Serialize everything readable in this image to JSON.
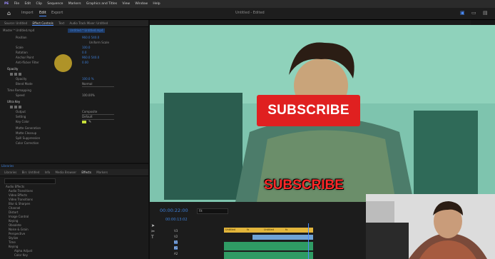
{
  "menu": {
    "app_title": "PE",
    "items": [
      "File",
      "Edit",
      "Clip",
      "Sequence",
      "Markers",
      "Graphics and Titles",
      "View",
      "Window",
      "Help"
    ]
  },
  "workspace": {
    "tabs": [
      "Import",
      "Edit",
      "Export"
    ],
    "active_tab": "Edit",
    "project_title": "Untitled - Edited"
  },
  "effects_panel": {
    "tabs": [
      "Source: Untitled",
      "Effect Controls",
      "Text",
      "Audio Track Mixer: Untitled"
    ],
    "active_tab": "Effect Controls",
    "master_label": "Master * Untitled.mp4",
    "clip_label": "Untitled * Untitled.mp4",
    "rows": [
      {
        "label": "Position",
        "value": "960.0   540.0"
      },
      {
        "label": "Scale",
        "value": "100.0"
      },
      {
        "label": "Scale Width",
        "value": "100.0"
      },
      {
        "label": "Uniform Scale",
        "value": ""
      },
      {
        "label": "Rotation",
        "value": "0.0"
      },
      {
        "label": "Anchor Point",
        "value": "960.0   540.0"
      },
      {
        "label": "Anti-flicker Filter",
        "value": "0.00"
      },
      {
        "label": "Opacity",
        "value": ""
      },
      {
        "label": "Opacity",
        "value": "100.0 %"
      },
      {
        "label": "Blend Mode",
        "value": "Normal"
      },
      {
        "label": "Time Remapping",
        "value": ""
      },
      {
        "label": "Speed",
        "value": "100.00%"
      },
      {
        "label": "Ultra Key",
        "value": ""
      },
      {
        "label": "Output",
        "value": "Composite"
      },
      {
        "label": "Setting",
        "value": "Default"
      },
      {
        "label": "Key Color",
        "value": ""
      },
      {
        "label": "Matte Generation",
        "value": ""
      },
      {
        "label": "Matte Cleanup",
        "value": ""
      },
      {
        "label": "Spill Suppression",
        "value": ""
      },
      {
        "label": "Color Correction",
        "value": ""
      }
    ]
  },
  "browser_panel": {
    "section": "Libraries",
    "tabs": [
      "Libraries",
      "Bin: Untitled",
      "Info",
      "Media Browser",
      "Effects",
      "Markers"
    ],
    "active_tab": "Effects",
    "tree": [
      "Audio Effects",
      "Audio Transitions",
      "Video Effects",
      "Video Transitions",
      "Blur & Sharpen",
      "Channel",
      "Distort",
      "Image Control",
      "Keying",
      "Obsolete",
      "Noise & Grain",
      "Perspective",
      "Stylize",
      "Time",
      "Keying",
      "Alpha Adjust",
      "Color Key",
      "Luma Key",
      "Track Matte Key"
    ]
  },
  "program_monitor": {
    "button_text": "SUBSCRIBE",
    "overlay_text": "SUBSCRIBE"
  },
  "timeline": {
    "timecode": "00:00:22:00",
    "fit_label": "Fit",
    "sequence_timecode": "00:00:13:02",
    "track_labels": [
      "V3",
      "V2",
      "V1",
      "A1",
      "A2",
      "A3"
    ],
    "clips": [
      "Untitled",
      "fx",
      "Untitled",
      "fx",
      "Untitled",
      "Untitled",
      "Untitled"
    ]
  },
  "colors": {
    "accent": "#3d7fd8",
    "subscribe_red": "#e02020",
    "video_tint": "#7fc2ad",
    "clip_gold": "#e2b53b",
    "audio_green": "#2f9b64"
  },
  "icons": [
    "home-icon",
    "program-monitor-icon",
    "layout-icon",
    "settings-icon",
    "selection-tool-icon",
    "razor-tool-icon",
    "text-tool-icon",
    "keyframe-icon",
    "eye-icon",
    "lock-icon",
    "mute-icon",
    "solo-icon",
    "eyedropper-icon"
  ]
}
